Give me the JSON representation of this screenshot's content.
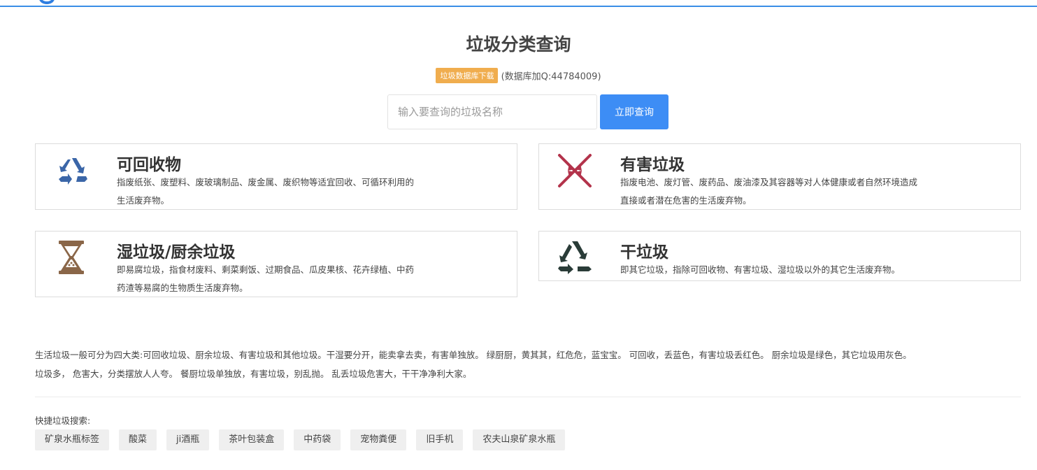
{
  "header": {
    "title": "垃圾分类查询"
  },
  "database": {
    "badge": "垃圾数据库下载",
    "note": "(数据库加Q:44784009)"
  },
  "search": {
    "placeholder": "输入要查询的垃圾名称",
    "value": "",
    "button_label": "立即查询"
  },
  "categories": [
    {
      "title": "可回收物",
      "icon": "recycle-arrows-icon",
      "color": "#3b66a8",
      "desc": [
        "指废纸张、废塑料、废玻璃制品、废金属、废织物等适宜回收、可循环利用的",
        "生活废弃物。"
      ]
    },
    {
      "title": "有害垃圾",
      "icon": "hazard-arrows-icon",
      "color": "#b3334b",
      "desc": [
        "指废电池、废灯管、废药品、废油漆及其容器等对人体健康或者自然环境造成",
        "直接或者潜在危害的生活废弃物。"
      ]
    },
    {
      "title": "湿垃圾/厨余垃圾",
      "icon": "hourglass-icon",
      "color": "#8a6648",
      "desc": [
        "即易腐垃圾，指食材废料、剩菜剩饭、过期食品、瓜皮果核、花卉绿植、中药",
        "药渣等易腐的生物质生活废弃物。"
      ]
    },
    {
      "title": "干垃圾",
      "icon": "triangle-recycle-icon",
      "color": "#2a3c38",
      "desc": [
        "即其它垃圾，指除可回收物、有害垃圾、湿垃圾以外的其它生活废弃物。"
      ]
    }
  ],
  "summary": [
    "生活垃圾一般可分为四大类:可回收垃圾、厨余垃圾、有害垃圾和其他垃圾。干湿要分开，能卖拿去卖，有害单独放。 绿厨厨，黄其其，红危危，蓝宝宝。 可回收，丢蓝色，有害垃圾丢红色。 厨余垃圾是绿色，其它垃圾用灰色。",
    "垃圾多， 危害大，分类摆放人人夸。 餐厨垃圾单独放，有害垃圾，别乱抛。 乱丢垃圾危害大，干干净净利大家。"
  ],
  "quick": {
    "label": "快捷垃圾搜索:",
    "tags": [
      "矿泉水瓶标签",
      "酸菜",
      "ji酒瓶",
      "茶叶包装盒",
      "中药袋",
      "宠物粪便",
      "旧手机",
      "农夫山泉矿泉水瓶"
    ]
  }
}
